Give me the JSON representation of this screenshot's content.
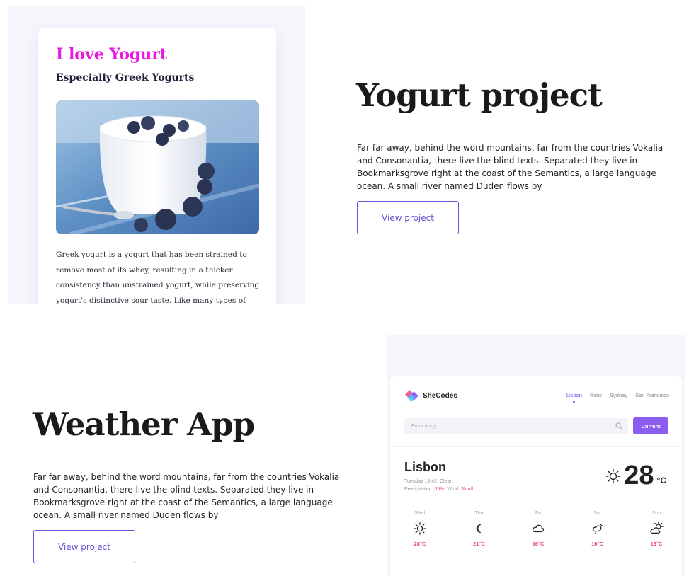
{
  "projects": [
    {
      "title": "Yogurt project",
      "description": "Far far away, behind the word mountains, far from the countries Vokalia and Consonantia, there live the blind texts. Separated they live in Bookmarksgrove right at the coast of the Semantics, a large language ocean. A small river named Duden flows by",
      "button_label": "View project"
    },
    {
      "title": "Weather App",
      "description": "Far far away, behind the word mountains, far from the countries Vokalia and Consonantia, there live the blind texts. Separated they live in Bookmarksgrove right at the coast of the Semantics, a large language ocean. A small river named Duden flows by",
      "button_label": "View project"
    }
  ],
  "yogurt_preview": {
    "title": "I love Yogurt",
    "subtitle": "Especially Greek Yogurts",
    "body": "Greek yogurt is a yogurt that has been strained to remove most of its whey, resulting in a thicker consistency than unstrained yogurt, while preserving yogurt's distinctive sour taste. Like many types of yogurt, strained yogurt is",
    "colors": {
      "title": "#e81ae0"
    }
  },
  "weather_preview": {
    "logo_text": "SheCodes",
    "cities": [
      "Lisbon",
      "Paris",
      "Sydney",
      "San Francisco"
    ],
    "active_city": "Lisbon",
    "search_placeholder": "Enter a city",
    "current_button": "Current",
    "city": "Lisbon",
    "datetime_desc": "Tuesday 18:42, Clear",
    "precip_label": "Precipitation: ",
    "precip_value": "65%",
    "wind_label": ", Wind: ",
    "wind_value": "3km/h",
    "temperature": "28",
    "unit": "°C",
    "current_icon": "sun-icon",
    "forecast": [
      {
        "day": "Wed",
        "icon": "sun-icon",
        "temp": "28°C"
      },
      {
        "day": "Thu",
        "icon": "moon-icon",
        "temp": "21°C"
      },
      {
        "day": "Fri",
        "icon": "cloud-icon",
        "temp": "16°C"
      },
      {
        "day": "Sat",
        "icon": "cloud-rain-icon",
        "temp": "16°C"
      },
      {
        "day": "Sun",
        "icon": "sun-cloud-icon",
        "temp": "16°C"
      }
    ],
    "colors": {
      "accent": "#8b5cf0",
      "highlight": "#e8457a"
    }
  }
}
